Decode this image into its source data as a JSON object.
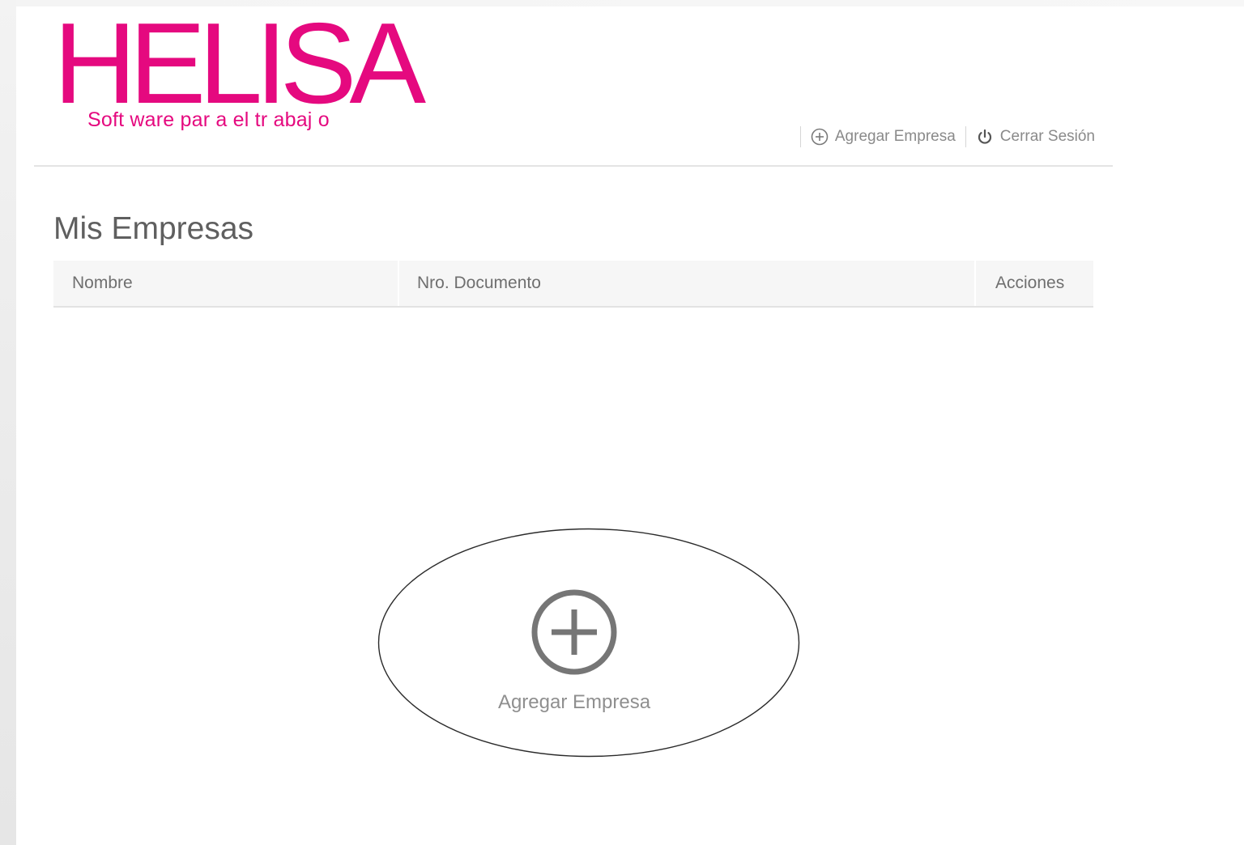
{
  "brand": {
    "name": "HELISA",
    "tagline": "Soft ware par a el tr abaj o",
    "color": "#e5097f"
  },
  "header": {
    "add_company_label": "Agregar Empresa",
    "logout_label": "Cerrar Sesión",
    "add_company_icon": "plus-circle-icon",
    "logout_icon": "power-icon"
  },
  "main": {
    "title": "Mis Empresas",
    "table": {
      "columns": [
        "Nombre",
        "Nro. Documento",
        "Acciones"
      ],
      "rows": []
    },
    "empty_state": {
      "add_label": "Agregar Empresa",
      "icon": "plus-circle-icon"
    }
  },
  "colors": {
    "accent": "#e5097f",
    "text_muted": "#8a8a8a",
    "header_bg": "#f6f6f6"
  }
}
